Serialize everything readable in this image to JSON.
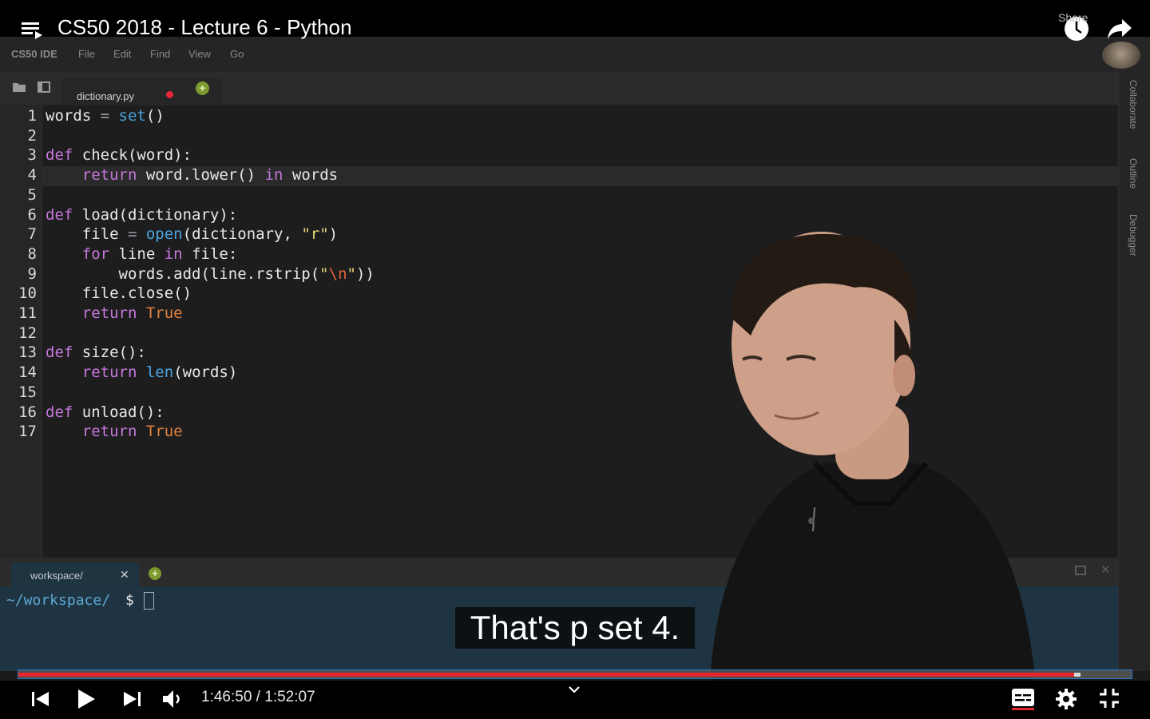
{
  "player": {
    "title": "CS50 2018 - Lecture 6 - Python",
    "share_label": "Share",
    "time_current": "1:46:50",
    "time_separator": " / ",
    "time_total": "1:52:07",
    "caption": "That's p set 4.",
    "progress_fraction": 0.948,
    "buffer_fraction": 0.954,
    "colors": {
      "progress": "#e5262b",
      "accent_border": "#2a78c8"
    }
  },
  "ide": {
    "brand": "CS50 IDE",
    "menu": [
      "File",
      "Edit",
      "Find",
      "View",
      "Go"
    ],
    "tab_label": "dictionary.py",
    "side_panel": [
      "Collaborate",
      "Outline",
      "Debugger"
    ],
    "code": [
      {
        "n": "1",
        "tokens": [
          [
            "plain",
            "words "
          ],
          [
            "op",
            "="
          ],
          [
            "plain",
            " "
          ],
          [
            "builtin",
            "set"
          ],
          [
            "plain",
            "()"
          ]
        ]
      },
      {
        "n": "2",
        "tokens": []
      },
      {
        "n": "3",
        "tokens": [
          [
            "keyword",
            "def"
          ],
          [
            "plain",
            " check(word):"
          ]
        ]
      },
      {
        "n": "4",
        "tokens": [
          [
            "plain",
            "    "
          ],
          [
            "keyword",
            "return"
          ],
          [
            "plain",
            " word.lower() "
          ],
          [
            "keyword",
            "in"
          ],
          [
            "plain",
            " words"
          ]
        ]
      },
      {
        "n": "5",
        "tokens": []
      },
      {
        "n": "6",
        "tokens": [
          [
            "keyword",
            "def"
          ],
          [
            "plain",
            " load(dictionary):"
          ]
        ]
      },
      {
        "n": "7",
        "tokens": [
          [
            "plain",
            "    file "
          ],
          [
            "op",
            "="
          ],
          [
            "plain",
            " "
          ],
          [
            "builtin",
            "open"
          ],
          [
            "plain",
            "(dictionary, "
          ],
          [
            "string",
            "\"r\""
          ],
          [
            "plain",
            ")"
          ]
        ]
      },
      {
        "n": "8",
        "tokens": [
          [
            "plain",
            "    "
          ],
          [
            "keyword",
            "for"
          ],
          [
            "plain",
            " line "
          ],
          [
            "keyword",
            "in"
          ],
          [
            "plain",
            " file:"
          ]
        ]
      },
      {
        "n": "9",
        "tokens": [
          [
            "plain",
            "        words.add(line.rstrip("
          ],
          [
            "string",
            "\""
          ],
          [
            "escape",
            "\\n"
          ],
          [
            "string",
            "\""
          ],
          [
            "plain",
            "))"
          ]
        ]
      },
      {
        "n": "10",
        "tokens": [
          [
            "plain",
            "    file.close()"
          ]
        ]
      },
      {
        "n": "11",
        "tokens": [
          [
            "plain",
            "    "
          ],
          [
            "keyword",
            "return"
          ],
          [
            "plain",
            " "
          ],
          [
            "const",
            "True"
          ]
        ]
      },
      {
        "n": "12",
        "tokens": []
      },
      {
        "n": "13",
        "tokens": [
          [
            "keyword",
            "def"
          ],
          [
            "plain",
            " size():"
          ]
        ]
      },
      {
        "n": "14",
        "tokens": [
          [
            "plain",
            "    "
          ],
          [
            "keyword",
            "return"
          ],
          [
            "plain",
            " "
          ],
          [
            "builtin",
            "len"
          ],
          [
            "plain",
            "(words)"
          ]
        ]
      },
      {
        "n": "15",
        "tokens": []
      },
      {
        "n": "16",
        "tokens": [
          [
            "keyword",
            "def"
          ],
          [
            "plain",
            " unload():"
          ]
        ]
      },
      {
        "n": "17",
        "tokens": [
          [
            "plain",
            "    "
          ],
          [
            "keyword",
            "return"
          ],
          [
            "plain",
            " "
          ],
          [
            "const",
            "True"
          ]
        ]
      }
    ],
    "current_line": "4",
    "terminal": {
      "tab_label": "workspace/",
      "prompt_path": "~/workspace/",
      "prompt_symbol": "$"
    }
  }
}
